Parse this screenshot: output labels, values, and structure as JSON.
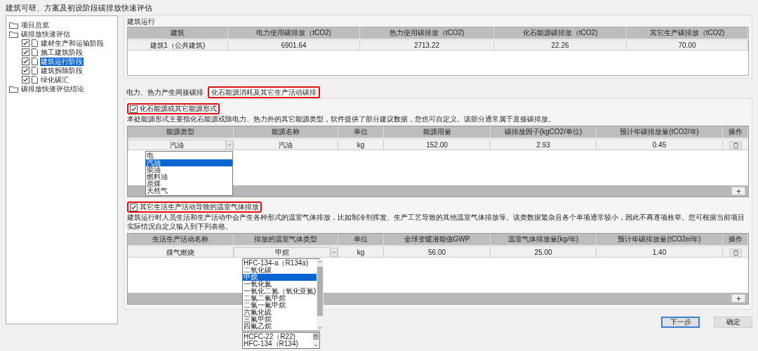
{
  "window": {
    "title": "建筑可研、方案及初设阶段碳排放快速评估"
  },
  "tree": [
    {
      "label": "项目总览",
      "kind": "folder",
      "selected": false
    },
    {
      "label": "碳排放快速评估",
      "kind": "folder",
      "selected": false,
      "children": [
        {
          "label": "建材生产和运输阶段",
          "kind": "page",
          "checked": true,
          "selected": false
        },
        {
          "label": "施工建筑阶段",
          "kind": "page",
          "checked": true,
          "selected": false
        },
        {
          "label": "建筑运行阶段",
          "kind": "page",
          "checked": true,
          "selected": true
        },
        {
          "label": "建筑拆除阶段",
          "kind": "page",
          "checked": true,
          "selected": false
        },
        {
          "label": "绿化碳汇",
          "kind": "page",
          "checked": true,
          "selected": false
        }
      ]
    },
    {
      "label": "碳排放快速评估结论",
      "kind": "folder",
      "selected": false
    }
  ],
  "summary": {
    "title": "建筑运行",
    "columns": [
      "建筑",
      "电力使用碳排放（tCO2)",
      "热力使用碳排放（tCO2)",
      "化石能源碳排放（tCO2)",
      "其它生产碳排放（tCO2)"
    ],
    "rows": [
      [
        "建筑1（公共建筑)",
        "6901.64",
        "2713.22",
        "22.26",
        "70.00"
      ]
    ]
  },
  "tabs": [
    {
      "label": "电力、热力产生间接碳排",
      "selected": false,
      "highlighted": false
    },
    {
      "label": "化石能源消耗及其它生产活动碳排",
      "selected": true,
      "highlighted": true
    }
  ],
  "sections": [
    {
      "checkbox": {
        "label": "化石能源或其它能源形式",
        "checked": true,
        "highlighted": true
      },
      "description": "本处能源形式主要指化石能源或除电力、热力外的其它能源类型，软件提供了部分建议数据，您也可自定义。该部分通常属于直接碳排放。",
      "columns": [
        "能源类型",
        "能源名称",
        "单位",
        "能源用量",
        "碳排放因子(kgCO2/单位)",
        "预计年碳排放量(tCO2/年)",
        "操作"
      ],
      "rows": [
        {
          "cells": [
            {
              "text": "汽油",
              "kind": "select"
            },
            {
              "text": "汽油",
              "kind": "text"
            },
            {
              "text": "kg",
              "kind": "text"
            },
            {
              "text": "152.00",
              "kind": "text"
            },
            {
              "text": "2.93",
              "kind": "text"
            },
            {
              "text": "0.45",
              "kind": "text"
            },
            {
              "kind": "delete"
            }
          ]
        }
      ],
      "dropdown": {
        "scrollable": false,
        "options": [
          {
            "label": "电",
            "selected": false
          },
          {
            "label": "汽油",
            "selected": true
          },
          {
            "label": "柴油",
            "selected": false
          },
          {
            "label": "燃料油",
            "selected": false
          },
          {
            "label": "原煤",
            "selected": false
          },
          {
            "label": "天然气",
            "selected": false
          }
        ]
      }
    },
    {
      "checkbox": {
        "label": "其它生活生产活动导致的温室气体排放",
        "checked": true,
        "highlighted": true
      },
      "description": "建筑运行时人员生活和生产活动中会产生各种形式的温室气体排放，比如制冷剂挥发、生产工艺导致的其他温室气体排放等。该类数据繁杂且各个单项通常较小，因此不再逐项枚举。您可根据当前项目实际情况自定义输入到下列表格。",
      "columns": [
        "生活生产活动名称",
        "排放的温室气体类型",
        "单位",
        "全球变暖潜能值GWP",
        "温室气体排放量(kg/年)",
        "预计年碳排放量(tCO2e/年)",
        "操作"
      ],
      "rows": [
        {
          "cells": [
            {
              "text": "煤气燃烧",
              "kind": "text"
            },
            {
              "text": "甲烷",
              "kind": "select"
            },
            {
              "text": "kg",
              "kind": "text"
            },
            {
              "text": "56.00",
              "kind": "text"
            },
            {
              "text": "25.00",
              "kind": "text"
            },
            {
              "text": "1.40",
              "kind": "text"
            },
            {
              "kind": "delete"
            }
          ]
        }
      ],
      "dropdown": {
        "scrollable": true,
        "options": [
          {
            "label": "HFC-134-a（R134a)",
            "selected": false
          },
          {
            "label": "二氧化碳",
            "selected": false
          },
          {
            "label": "甲烷",
            "selected": true
          },
          {
            "label": "一氧化氮",
            "selected": false
          },
          {
            "label": "一氧化二氮（氧化亚氮)",
            "selected": false
          },
          {
            "label": "二氯二氟甲烷",
            "selected": false
          },
          {
            "label": "二氯一氟甲烷",
            "selected": false
          },
          {
            "label": "六氟化硫",
            "selected": false
          },
          {
            "label": "三氟甲烷",
            "selected": false
          },
          {
            "label": "四氟乙烷",
            "selected": false
          }
        ],
        "extra_options": [
          {
            "label": "HCFC-22（R22)",
            "selected": false
          },
          {
            "label": "HFC-134（R134)",
            "selected": false
          }
        ]
      }
    }
  ],
  "buttons": [
    {
      "label": "下一步",
      "selected": true
    },
    {
      "label": "确定",
      "selected": false
    }
  ]
}
